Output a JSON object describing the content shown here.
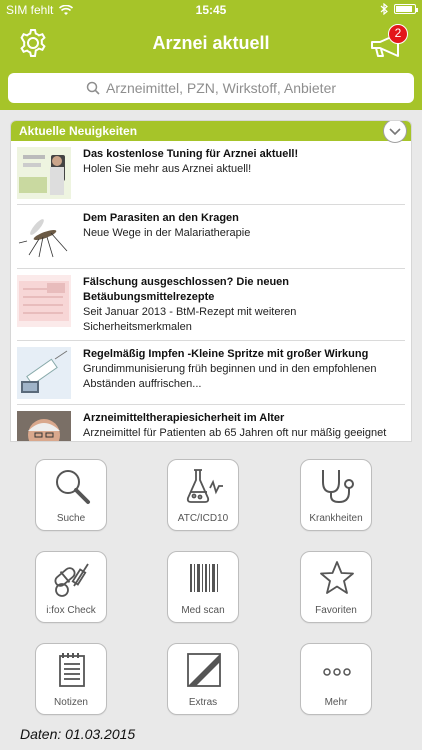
{
  "statusbar": {
    "carrier": "SIM fehlt",
    "time": "15:45",
    "battery_level": 0.9
  },
  "navbar": {
    "title": "Arznei aktuell",
    "settings_icon": "gear-icon",
    "notifications_icon": "megaphone-icon",
    "notification_badge": "2",
    "badge_color": "#e3171b"
  },
  "theme": {
    "accent": "#a6c429"
  },
  "search": {
    "placeholder": "Arzneimittel, PZN, Wirkstoff, Anbieter"
  },
  "news": {
    "header": "Aktuelle Neuigkeiten",
    "items": [
      {
        "headline": "Das kostenlose Tuning für Arznei aktuell!",
        "desc": "Holen Sie mehr aus Arznei aktuell!",
        "thumb_icon": "promo-thumbnail"
      },
      {
        "headline": "Dem Parasiten an den Kragen",
        "desc": "Neue Wege in der Malariatherapie",
        "thumb_icon": "mosquito-thumbnail"
      },
      {
        "headline": "Fälschung ausgeschlossen? Die neuen Betäubungsmittelrezepte",
        "desc": "Seit Januar 2013 - BtM-Rezept mit weiteren Sicherheitsmerkmalen",
        "thumb_icon": "prescription-thumbnail"
      },
      {
        "headline": "Regelmäßig Impfen -Kleine Spritze mit großer Wirkung",
        "desc": "Grundimmunisierung früh beginnen und in den empfohlenen Abständen auffrischen...",
        "thumb_icon": "syringe-thumbnail"
      },
      {
        "headline": "Arzneimitteltherapiesicherheit im Alter",
        "desc": "Arzneimittel für Patienten ab 65 Jahren oft nur mäßig geeignet",
        "thumb_icon": "elderly-man-thumbnail"
      }
    ]
  },
  "tiles": [
    {
      "label": "Suche",
      "icon": "magnifier-icon"
    },
    {
      "label": "ATC/ICD10",
      "icon": "lab-flask-icon"
    },
    {
      "label": "Krankheiten",
      "icon": "stethoscope-icon"
    },
    {
      "label": "i:fox Check",
      "icon": "pills-syringe-icon"
    },
    {
      "label": "Med scan",
      "icon": "barcode-icon"
    },
    {
      "label": "Favoriten",
      "icon": "star-icon"
    },
    {
      "label": "Notizen",
      "icon": "notepad-icon"
    },
    {
      "label": "Extras",
      "icon": "ifap-logo-icon"
    },
    {
      "label": "Mehr",
      "icon": "more-dots-icon"
    }
  ],
  "footer": {
    "date_text": "Daten: 01.03.2015"
  }
}
